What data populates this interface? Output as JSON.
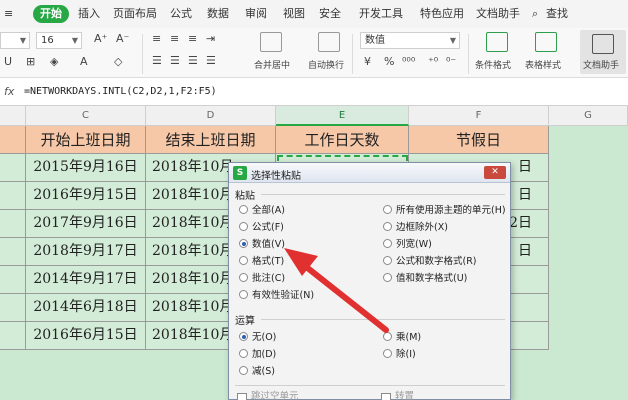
{
  "ribbon": {
    "tabs": [
      "开始",
      "插入",
      "页面布局",
      "公式",
      "数据",
      "审阅",
      "视图",
      "安全",
      "开发工具",
      "特色应用",
      "文档助手",
      "查找"
    ],
    "active_tab": "开始"
  },
  "toolbar": {
    "font_size": "16",
    "number_format": "数值",
    "merge_center_label": "合并居中",
    "wrap_label": "自动换行",
    "conditional_format_label": "条件格式",
    "table_style_label": "表格样式",
    "doc_assistant_label": "文档助手"
  },
  "formula_bar": {
    "fx": "fx",
    "formula": "=NETWORKDAYS.INTL(C2,D2,1,F2:F5)"
  },
  "grid": {
    "columns": [
      "C",
      "D",
      "E",
      "F",
      "G"
    ],
    "selected_column": "E",
    "headers": [
      "开始上班日期",
      "结束上班日期",
      "工作日天数",
      "节假日"
    ],
    "rows": [
      [
        "2015年9月16日",
        "2018年10月",
        "",
        "日"
      ],
      [
        "2016年9月15日",
        "2018年10月",
        "",
        "日"
      ],
      [
        "2017年9月16日",
        "2018年10月",
        "",
        "2日"
      ],
      [
        "2018年9月17日",
        "2018年10月",
        "",
        "日"
      ],
      [
        "2014年9月17日",
        "2018年10月",
        "",
        ""
      ],
      [
        "2014年6月18日",
        "2018年10月",
        "",
        ""
      ],
      [
        "2016年6月15日",
        "2018年10月",
        "",
        ""
      ]
    ]
  },
  "dialog": {
    "title": "选择性粘贴",
    "close": "✕",
    "paste_group": "粘贴",
    "paste_left": [
      "全部(A)",
      "公式(F)",
      "数值(V)",
      "格式(T)",
      "批注(C)",
      "有效性验证(N)"
    ],
    "paste_right": [
      "所有使用源主题的单元(H)",
      "边框除外(X)",
      "列宽(W)",
      "公式和数字格式(R)",
      "值和数字格式(U)"
    ],
    "selected_paste": "数值(V)",
    "operation_group": "运算",
    "operation_left": [
      "无(O)",
      "加(D)",
      "减(S)"
    ],
    "operation_right": [
      "乘(M)",
      "除(I)"
    ],
    "selected_operation": "无(O)",
    "bottom_left": "跳过空单元",
    "bottom_right": "转置"
  }
}
